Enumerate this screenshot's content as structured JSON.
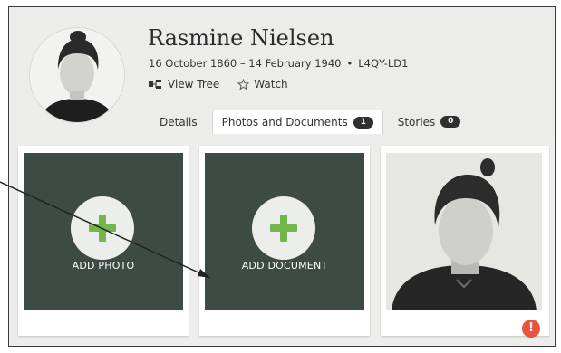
{
  "person": {
    "name": "Rasmine Nielsen",
    "lifespan": "16 October 1860 – 14 February 1940",
    "separator": "•",
    "id": "L4QY-LD1"
  },
  "actions": [
    {
      "label": "View Tree",
      "icon": "tree-icon"
    },
    {
      "label": "Watch",
      "icon": "star-icon"
    }
  ],
  "tabs": [
    {
      "label": "Details",
      "active": false
    },
    {
      "label": "Photos and Documents",
      "count": "1",
      "active": true
    },
    {
      "label": "Stories",
      "count": "0",
      "active": false
    }
  ],
  "cards": {
    "add_photo": {
      "label": "ADD PHOTO",
      "icon": "plus-icon"
    },
    "add_document": {
      "label": "ADD DOCUMENT",
      "icon": "plus-icon"
    },
    "photo": {
      "alert": "!",
      "icon": "alert-icon"
    }
  },
  "colors": {
    "tile_background": "#3e4a44",
    "plus_green": "#74b64c",
    "alert_red": "#e8553e",
    "badge_dark": "#2f2f2f"
  }
}
